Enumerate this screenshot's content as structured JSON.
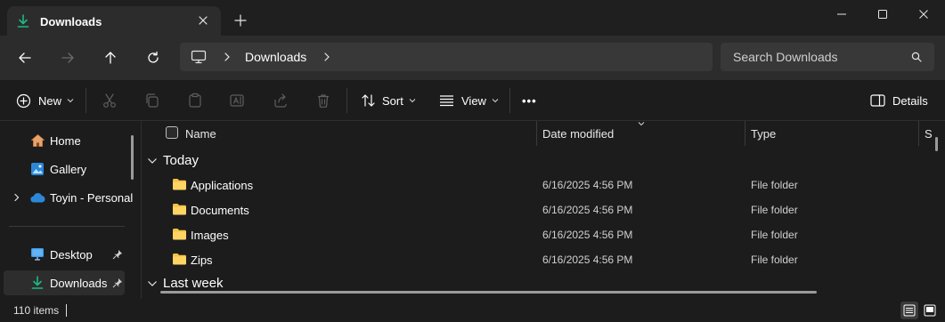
{
  "tab": {
    "title": "Downloads"
  },
  "address": {
    "crumb": "Downloads"
  },
  "search": {
    "placeholder": "Search Downloads"
  },
  "commands": {
    "new_label": "New",
    "sort_label": "Sort",
    "view_label": "View",
    "more_label": "•••",
    "details_label": "Details"
  },
  "sidebar": {
    "items": [
      {
        "label": "Home"
      },
      {
        "label": "Gallery"
      },
      {
        "label": "Toyin - Personal"
      },
      {
        "label": "Desktop"
      },
      {
        "label": "Downloads"
      }
    ]
  },
  "columns": {
    "name": "Name",
    "date": "Date modified",
    "type": "Type",
    "size": "S"
  },
  "groups": {
    "today": "Today",
    "last_week": "Last week"
  },
  "rows": [
    {
      "name": "Applications",
      "date": "6/16/2025 4:56 PM",
      "type": "File folder"
    },
    {
      "name": "Documents",
      "date": "6/16/2025 4:56 PM",
      "type": "File folder"
    },
    {
      "name": "Images",
      "date": "6/16/2025 4:56 PM",
      "type": "File folder"
    },
    {
      "name": "Zips",
      "date": "6/16/2025 4:56 PM",
      "type": "File folder"
    }
  ],
  "status": {
    "count": "110 items"
  },
  "colors": {
    "accent_green": "#1db985",
    "folder_yellow": "#f6c245",
    "onedrive_blue": "#2b88d8"
  }
}
